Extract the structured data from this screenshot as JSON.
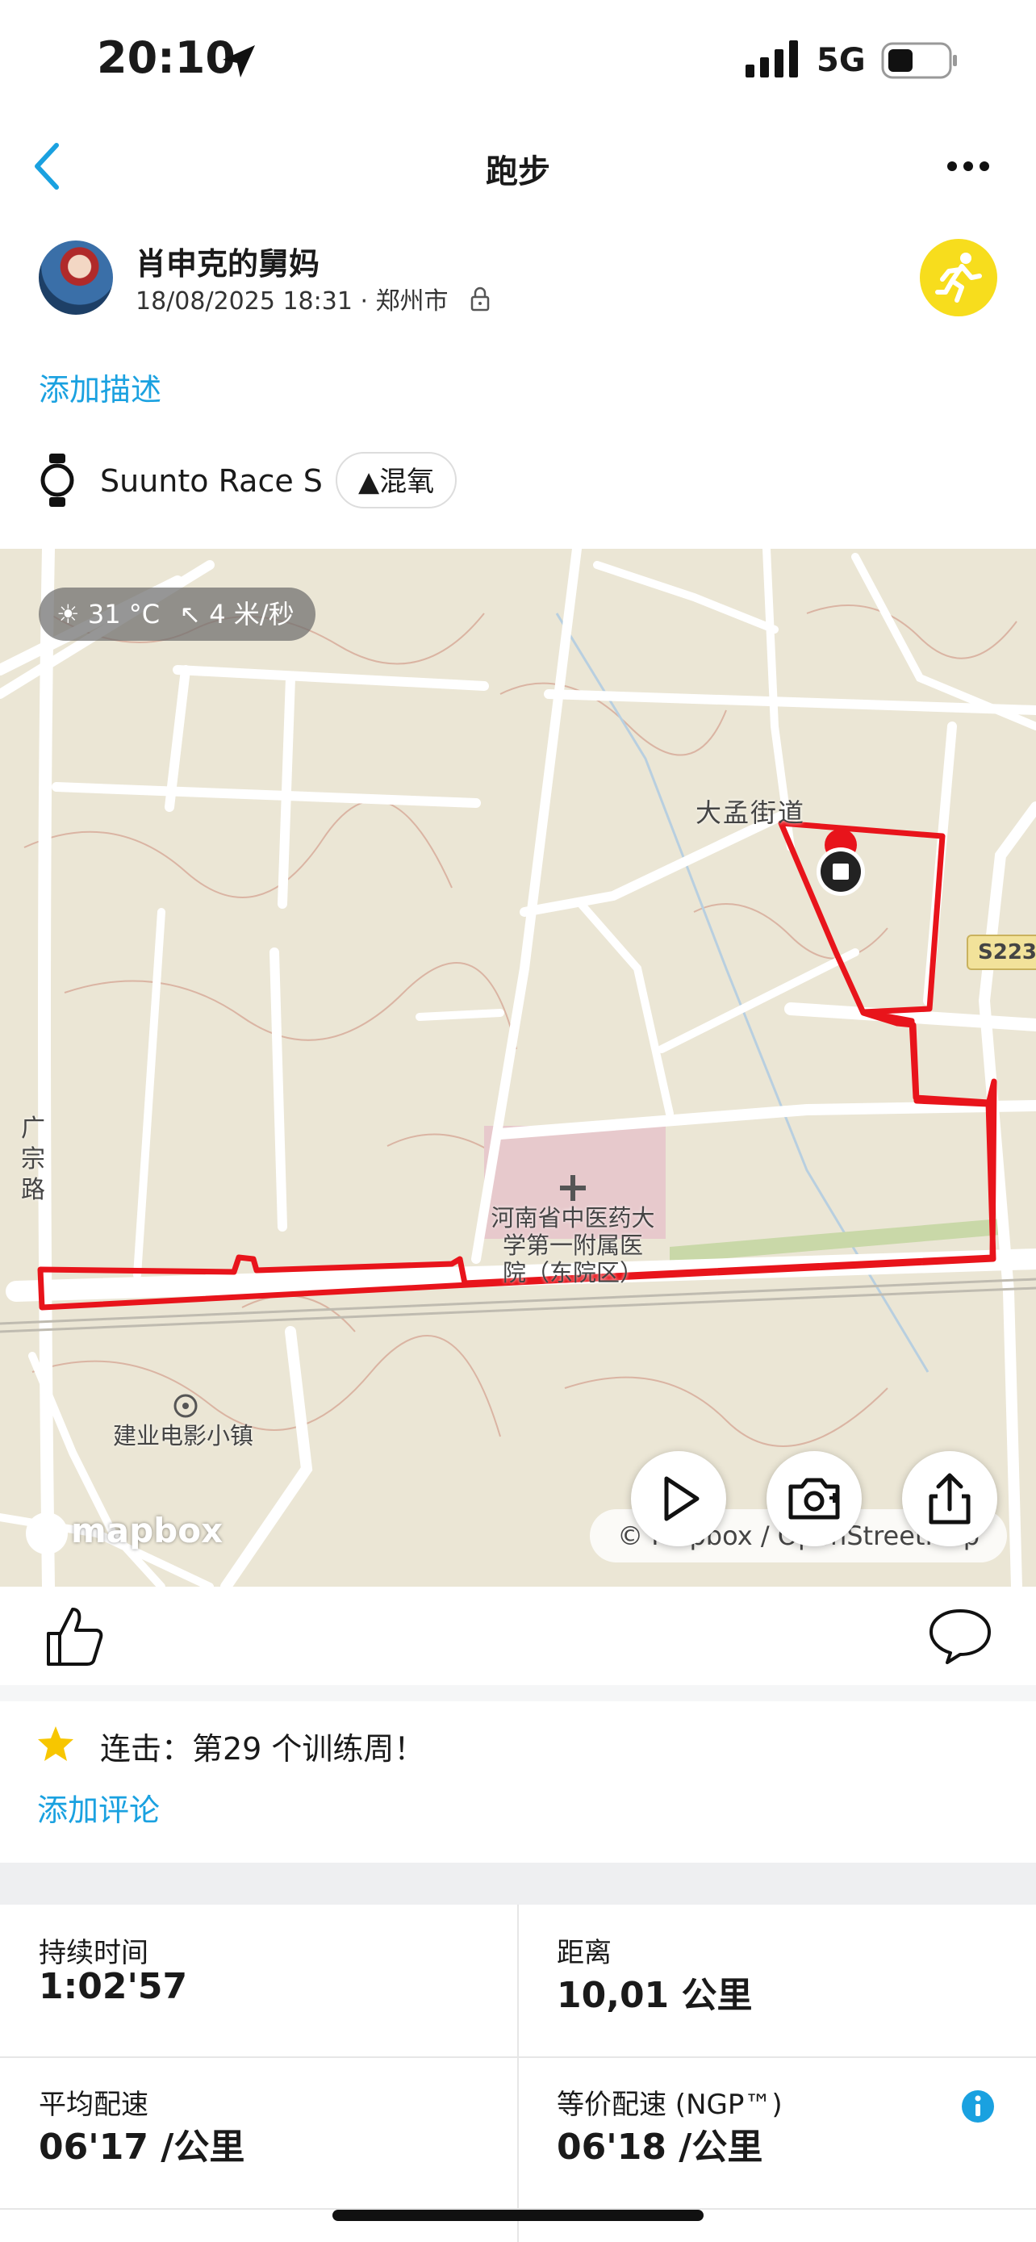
{
  "status_bar": {
    "time": "20:10",
    "network": "5G"
  },
  "nav": {
    "title": "跑步"
  },
  "profile": {
    "name": "肖申克的舅妈",
    "meta": "18/08/2025 18:31 · 郑州市"
  },
  "add_description": "添加描述",
  "device": {
    "name": "Suunto Race S",
    "chip_label": "混氧"
  },
  "map": {
    "weather_temp": "31 °C",
    "weather_wind": "4 米/秒",
    "labels": {
      "street": "大孟街道",
      "road_badge": "S223",
      "road_left": "广宗路",
      "hospital_line1": "河南省中医药大",
      "hospital_line2": "学第一附属医",
      "hospital_line3": "院（东院区）",
      "poi": "建业电影小镇"
    },
    "brand": "mapbox",
    "attribution": "© Mapbox / OpenStreetMap",
    "route_color": "#e8141b"
  },
  "social": {
    "streak": "连击：第29 个训练周！",
    "add_comment": "添加评论"
  },
  "stats": [
    {
      "label": "持续时间",
      "value": "1:02'57"
    },
    {
      "label": "距离",
      "value": "10,01 公里"
    },
    {
      "label": "平均配速",
      "value": "06'17 /公里"
    },
    {
      "label": "等价配速 (NGP™)",
      "value": "06'18 /公里"
    }
  ],
  "colors": {
    "accent": "#1aa1e0",
    "badge": "#f7dd1d",
    "star": "#f7c600"
  }
}
